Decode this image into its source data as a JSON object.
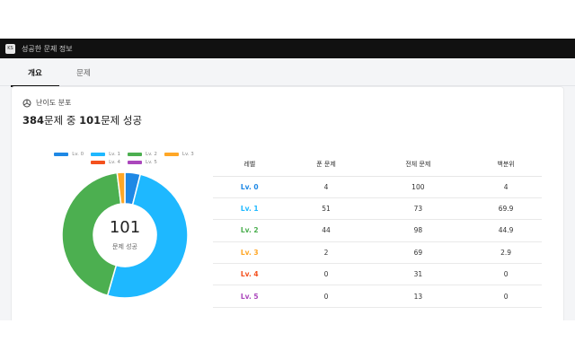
{
  "window": {
    "title": "성공한 문제 정보",
    "icon_text": "KS"
  },
  "tabs": [
    {
      "label": "개요"
    },
    {
      "label": "문제"
    }
  ],
  "section": {
    "icon": "pie-chart-icon",
    "title": "난이도 분포",
    "summary": {
      "total": "384",
      "text_mid": "문제 중 ",
      "solved": "101",
      "text_end": "문제 성공"
    }
  },
  "chart_data": {
    "type": "pie",
    "categories": [
      "Lv. 0",
      "Lv. 1",
      "Lv. 2",
      "Lv. 3",
      "Lv. 4",
      "Lv. 5"
    ],
    "values": [
      4,
      51,
      44,
      2,
      0,
      0
    ],
    "colors": [
      "#1e88e5",
      "#1eb8ff",
      "#4caf50",
      "#ffa726",
      "#f4511e",
      "#ab47bc"
    ],
    "center_value": "101",
    "center_label": "문제 성공",
    "legend_position": "top"
  },
  "table": {
    "headers": [
      "레벨",
      "푼 문제",
      "전체 문제",
      "백분위"
    ],
    "rows": [
      {
        "level": "Lv. 0",
        "solved": "4",
        "total": "100",
        "percent": "4",
        "color": "#1e88e5"
      },
      {
        "level": "Lv. 1",
        "solved": "51",
        "total": "73",
        "percent": "69.9",
        "color": "#1eb8ff"
      },
      {
        "level": "Lv. 2",
        "solved": "44",
        "total": "98",
        "percent": "44.9",
        "color": "#4caf50"
      },
      {
        "level": "Lv. 3",
        "solved": "2",
        "total": "69",
        "percent": "2.9",
        "color": "#ffa726"
      },
      {
        "level": "Lv. 4",
        "solved": "0",
        "total": "31",
        "percent": "0",
        "color": "#f4511e"
      },
      {
        "level": "Lv. 5",
        "solved": "0",
        "total": "13",
        "percent": "0",
        "color": "#ab47bc"
      }
    ]
  }
}
